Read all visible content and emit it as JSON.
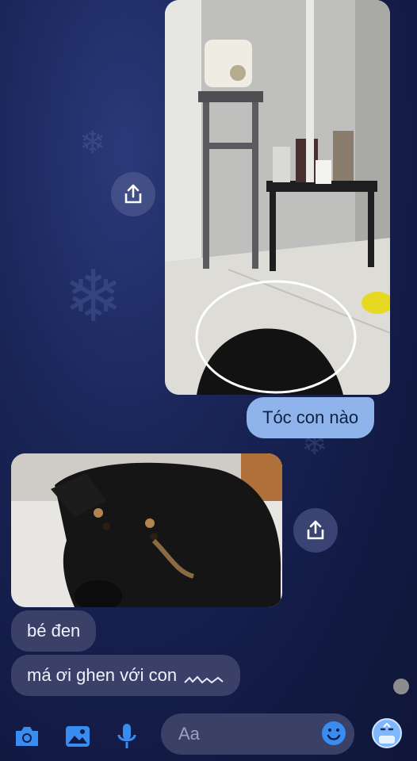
{
  "messages": [
    {
      "type": "image",
      "direction": "outgoing",
      "description_icon": "photo-with-circled-dog"
    },
    {
      "type": "text",
      "direction": "outgoing",
      "text": "Tóc con nào"
    },
    {
      "type": "image",
      "direction": "incoming",
      "description_icon": "black-dog-photo"
    },
    {
      "type": "text",
      "direction": "incoming",
      "text": "bé đen"
    },
    {
      "type": "text",
      "direction": "incoming",
      "text": "má ơi ghen với con"
    }
  ],
  "composer": {
    "placeholder": "Aa",
    "icons": [
      "camera-icon",
      "image-icon",
      "microphone-icon",
      "emoji-icon",
      "reaction-icon"
    ]
  },
  "colors": {
    "accent": "#3a8df0",
    "outgoing_bubble": "#8fb4ec",
    "incoming_bubble": "#3a4068",
    "background": "#131b45"
  }
}
